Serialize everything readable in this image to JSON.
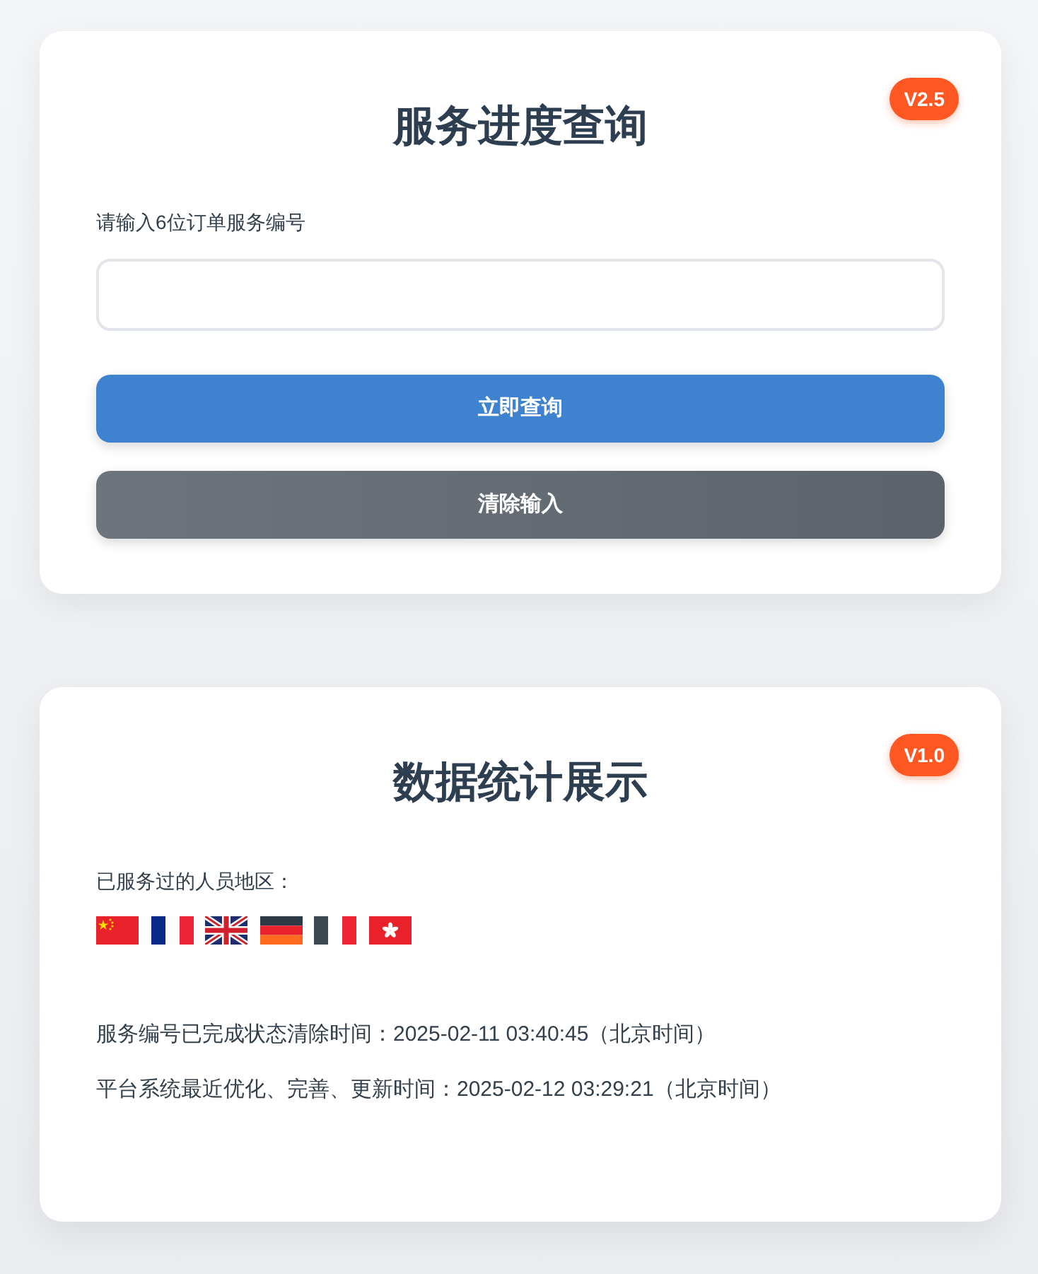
{
  "query_card": {
    "version_badge": "V2.5",
    "title": "服务进度查询",
    "order_field": {
      "label": "请输入6位订单服务编号"
    },
    "buttons": [
      {
        "label": "立即查询",
        "kind": "primary"
      },
      {
        "label": "清除输入",
        "kind": "secondary"
      }
    ]
  },
  "stats_card": {
    "version_badge": "V1.0",
    "title": "数据统计展示",
    "regions_label": "已服务过的人员地区：",
    "lines": [
      "服务编号已完成状态清除时间：2025-02-11 03:40:45（北京时间）",
      "平台系统最近优化、完善、更新时间：2025-02-12 03:29:21（北京时间）"
    ]
  }
}
